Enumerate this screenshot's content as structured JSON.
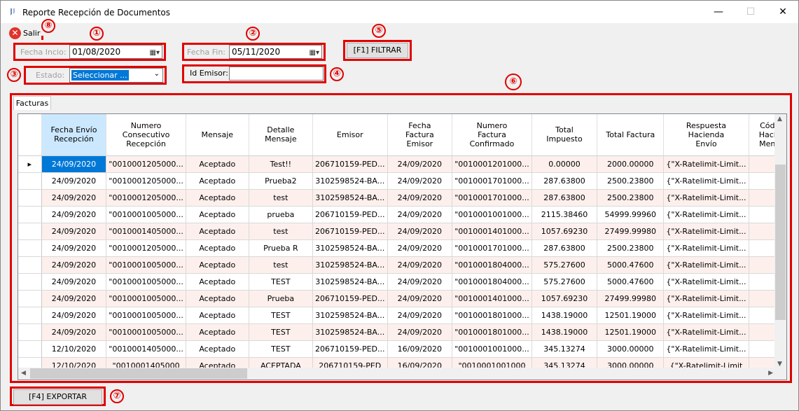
{
  "window": {
    "title": "Reporte Recepción de Documentos"
  },
  "toolbar": {
    "salir_label": "Salir"
  },
  "filters": {
    "fecha_inicio_label": "Fecha Incio:",
    "fecha_inicio_value": "01/08/2020",
    "fecha_fin_label": "Fecha Fin:",
    "fecha_fin_value": "05/11/2020",
    "estado_label": "Estado:",
    "estado_value": "Seleccionar ...",
    "id_emisor_label": "Id Emisor:",
    "id_emisor_value": "",
    "filtrar_label": "[F1] FILTRAR"
  },
  "tabs": [
    {
      "label": "Facturas"
    }
  ],
  "table": {
    "columns": [
      "Fecha Envío\nRecepción",
      "Numero\nConsecutivo\nRecepción",
      "Mensaje",
      "Detalle\nMensaje",
      "Emisor",
      "Fecha\nFactura\nEmisor",
      "Numero\nFactura\nConfirmado",
      "Total\nImpuesto",
      "Total Factura",
      "Respuesta\nHacienda\nEnvío",
      "Cód\nHaci\nMen"
    ],
    "rows": [
      [
        "24/09/2020",
        "\"0010001205000...",
        "Aceptado",
        "Test!!",
        "206710159-PED...",
        "24/09/2020",
        "\"0010001201000...",
        "0.00000",
        "2000.00000",
        "{\"X-Ratelimit-Limit...",
        ""
      ],
      [
        "24/09/2020",
        "\"0010001205000...",
        "Aceptado",
        "Prueba2",
        "3102598524-BA...",
        "24/09/2020",
        "\"0010001701000...",
        "287.63800",
        "2500.23800",
        "{\"X-Ratelimit-Limit...",
        ""
      ],
      [
        "24/09/2020",
        "\"0010001205000...",
        "Aceptado",
        "test",
        "3102598524-BA...",
        "24/09/2020",
        "\"0010001701000...",
        "287.63800",
        "2500.23800",
        "{\"X-Ratelimit-Limit...",
        ""
      ],
      [
        "24/09/2020",
        "\"0010001005000...",
        "Aceptado",
        "prueba",
        "206710159-PED...",
        "24/09/2020",
        "\"0010001001000...",
        "2115.38460",
        "54999.99960",
        "{\"X-Ratelimit-Limit...",
        ""
      ],
      [
        "24/09/2020",
        "\"0010001405000...",
        "Aceptado",
        "test",
        "206710159-PED...",
        "24/09/2020",
        "\"0010001401000...",
        "1057.69230",
        "27499.99980",
        "{\"X-Ratelimit-Limit...",
        ""
      ],
      [
        "24/09/2020",
        "\"0010001205000...",
        "Aceptado",
        "Prueba R",
        "3102598524-BA...",
        "24/09/2020",
        "\"0010001701000...",
        "287.63800",
        "2500.23800",
        "{\"X-Ratelimit-Limit...",
        ""
      ],
      [
        "24/09/2020",
        "\"0010001005000...",
        "Aceptado",
        "test",
        "3102598524-BA...",
        "24/09/2020",
        "\"0010001804000...",
        "575.27600",
        "5000.47600",
        "{\"X-Ratelimit-Limit...",
        ""
      ],
      [
        "24/09/2020",
        "\"0010001005000...",
        "Aceptado",
        "TEST",
        "3102598524-BA...",
        "24/09/2020",
        "\"0010001804000...",
        "575.27600",
        "5000.47600",
        "{\"X-Ratelimit-Limit...",
        ""
      ],
      [
        "24/09/2020",
        "\"0010001005000...",
        "Aceptado",
        "Prueba",
        "206710159-PED...",
        "24/09/2020",
        "\"0010001401000...",
        "1057.69230",
        "27499.99980",
        "{\"X-Ratelimit-Limit...",
        ""
      ],
      [
        "24/09/2020",
        "\"0010001005000...",
        "Aceptado",
        "TEST",
        "3102598524-BA...",
        "24/09/2020",
        "\"0010001801000...",
        "1438.19000",
        "12501.19000",
        "{\"X-Ratelimit-Limit...",
        ""
      ],
      [
        "24/09/2020",
        "\"0010001005000...",
        "Aceptado",
        "TEST",
        "3102598524-BA...",
        "24/09/2020",
        "\"0010001801000...",
        "1438.19000",
        "12501.19000",
        "{\"X-Ratelimit-Limit...",
        ""
      ],
      [
        "12/10/2020",
        "\"0010001405000...",
        "Aceptado",
        "TEST",
        "206710159-PED...",
        "16/09/2020",
        "\"0010001001000...",
        "345.13274",
        "3000.00000",
        "{\"X-Ratelimit-Limit...",
        ""
      ],
      [
        "12/10/2020",
        "\"0010001405000",
        "Aceptado",
        "ACEPTADA",
        "206710159-PED",
        "16/09/2020",
        "\"0010001001000",
        "345.13274",
        "3000.00000",
        "{\"X-Ratelimit-Limit",
        ""
      ]
    ]
  },
  "footer": {
    "exportar_label": "[F4] EXPORTAR"
  },
  "annotations": [
    "①",
    "②",
    "③",
    "④",
    "⑤",
    "⑥",
    "⑦",
    "⑧"
  ],
  "colors": {
    "annotation": "#e00000",
    "selection": "#0078d7",
    "odd_row": "#fdf0ec"
  }
}
